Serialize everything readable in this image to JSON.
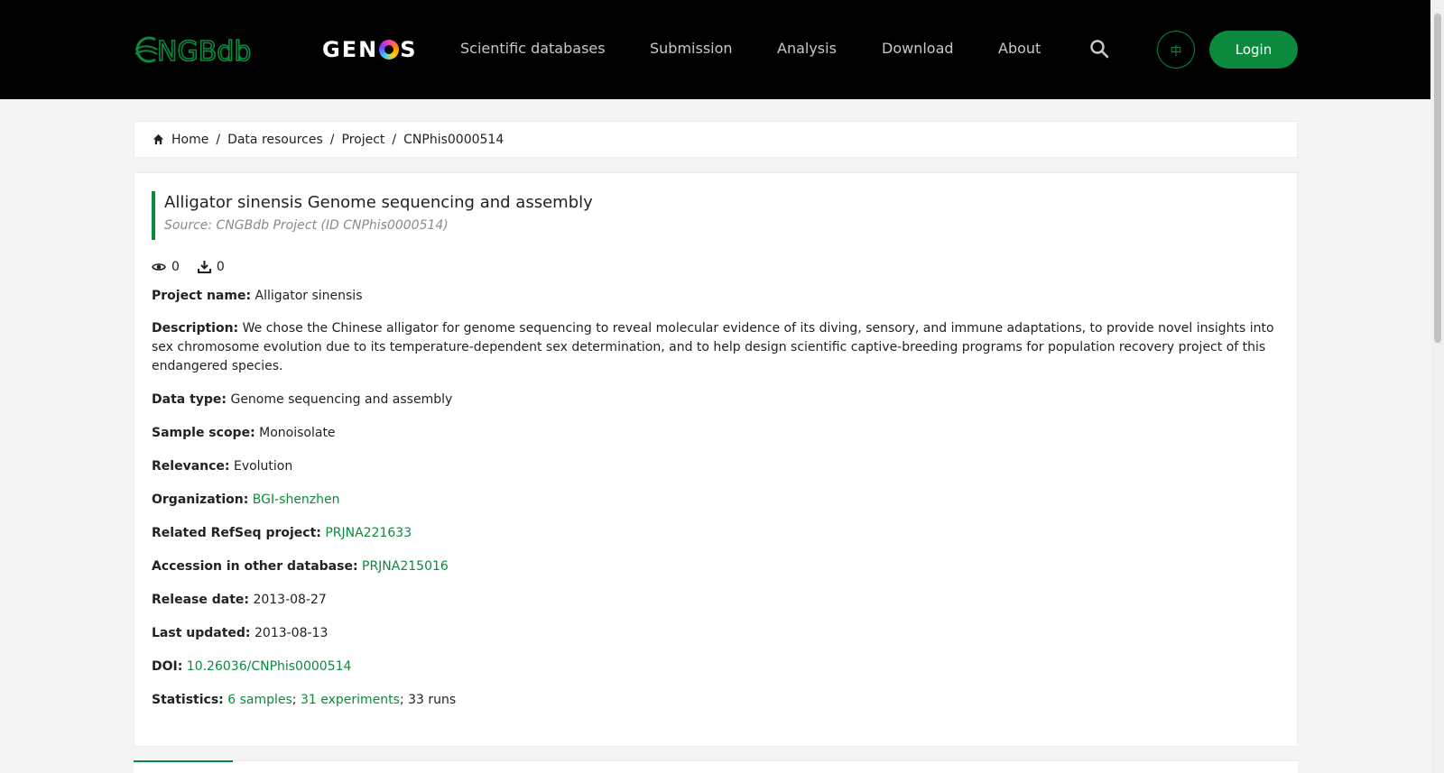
{
  "header": {
    "logo_cngb": "CNGBdb",
    "logo_genos_left": "GEN",
    "logo_genos_right": "S",
    "nav": [
      "Scientific databases",
      "Submission",
      "Analysis",
      "Download",
      "About"
    ],
    "lang_label": "中",
    "login_label": "Login",
    "accent_color": "#0b8a3e"
  },
  "breadcrumb": {
    "items": [
      "Home",
      "Data resources",
      "Project",
      "CNPhis0000514"
    ],
    "separator": "/"
  },
  "project": {
    "title": "Alligator sinensis Genome sequencing and assembly",
    "source": "Source: CNGBdb Project (ID CNPhis0000514)",
    "views": "0",
    "downloads": "0",
    "fields": {
      "project_name": {
        "label": "Project name:",
        "value": "Alligator sinensis"
      },
      "description": {
        "label": "Description:",
        "value": "We chose the Chinese alligator for genome sequencing to reveal molecular evidence of its diving, sensory, and immune adaptations, to provide novel insights into sex chromosome evolution due to its temperature-dependent sex determination, and to help design scientific captive-breeding programs for population recovery project of this endangered species."
      },
      "data_type": {
        "label": "Data type:",
        "value": "Genome sequencing and assembly"
      },
      "sample_scope": {
        "label": "Sample scope:",
        "value": "Monoisolate"
      },
      "relevance": {
        "label": "Relevance:",
        "value": "Evolution"
      },
      "organization": {
        "label": "Organization:",
        "value": "BGI-shenzhen"
      },
      "refseq": {
        "label": "Related RefSeq project:",
        "value": "PRJNA221633"
      },
      "other_db": {
        "label": "Accession in other database:",
        "value": "PRJNA215016"
      },
      "release_date": {
        "label": "Release date:",
        "value": "2013-08-27"
      },
      "last_updated": {
        "label": "Last updated:",
        "value": "2013-08-13"
      },
      "doi": {
        "label": "DOI:",
        "value": "10.26036/CNPhis0000514"
      },
      "statistics": {
        "label": "Statistics:",
        "samples": "6 samples",
        "sep1": "; ",
        "experiments": "31 experiments",
        "runs": "; 33 runs"
      }
    }
  }
}
